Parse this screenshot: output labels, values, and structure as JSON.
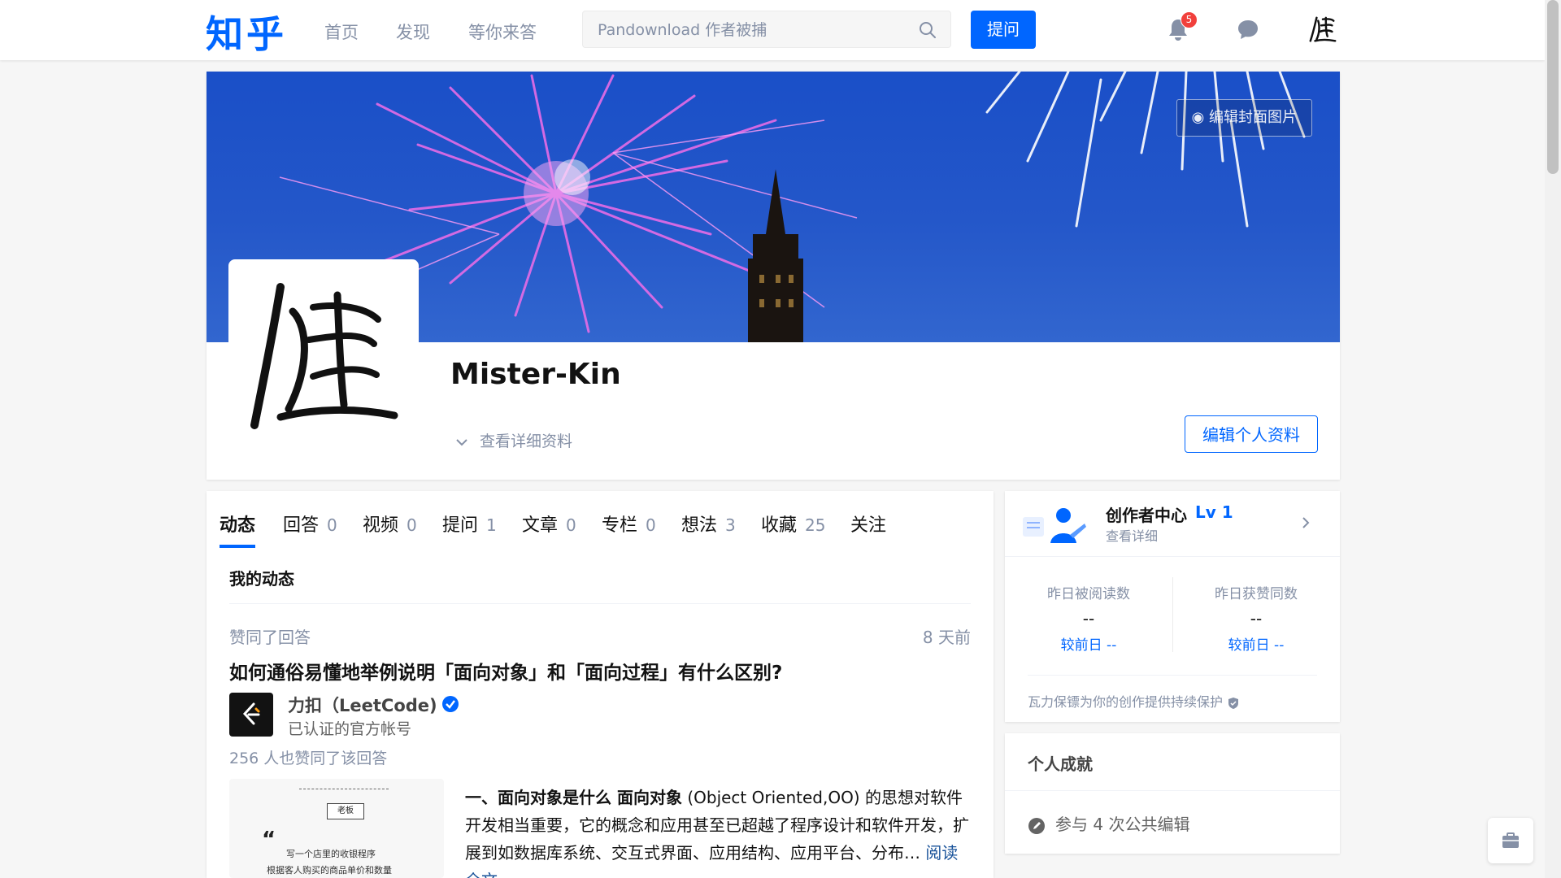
{
  "header": {
    "logo": "知乎",
    "nav": [
      "首页",
      "发现",
      "等你来答"
    ],
    "search_placeholder": "Pandownload 作者被捕",
    "ask_label": "提问",
    "notification_count": "5",
    "brand_color": "#0066ff"
  },
  "profile": {
    "edit_cover_label": "编辑封面图片",
    "username": "Mister-Kin",
    "view_details": "查看详细资料",
    "edit_profile": "编辑个人资料"
  },
  "tabs": [
    {
      "label": "动态",
      "count": ""
    },
    {
      "label": "回答",
      "count": "0"
    },
    {
      "label": "视频",
      "count": "0"
    },
    {
      "label": "提问",
      "count": "1"
    },
    {
      "label": "文章",
      "count": "0"
    },
    {
      "label": "专栏",
      "count": "0"
    },
    {
      "label": "想法",
      "count": "3"
    },
    {
      "label": "收藏",
      "count": "25"
    },
    {
      "label": "关注",
      "count": ""
    }
  ],
  "feed": {
    "section_title": "我的动态",
    "item": {
      "action": "赞同了回答",
      "time": "8 天前",
      "title": "如何通俗易懂地举例说明「面向对象」和「面向过程」有什么区别?",
      "author_name": "力扣（LeetCode)",
      "author_desc": "已认证的官方帐号",
      "likes": "256 人也赞同了该回答",
      "thumb_box": "老板",
      "thumb_quote": "“",
      "thumb_line1": "写一个店里的收银程序",
      "thumb_line2": "根据客人购买的商品单价和数量",
      "excerpt_bold": "一、面向对象是什么 面向对象",
      "excerpt_text": " (Object Oriented,OO) 的思想对软件开发相当重要，它的概念和应用甚至已超越了程序设计和软件开发，扩展到如数据库系统、交互式界面、应用结构、应用平台、分布…",
      "read_more": "阅读全文"
    }
  },
  "creator": {
    "title": "创作者中心",
    "level": "Lv 1",
    "subtitle": "查看详细",
    "stats": [
      {
        "label": "昨日被阅读数",
        "value": "--",
        "compare": "较前日 --"
      },
      {
        "label": "昨日获赞同数",
        "value": "--",
        "compare": "较前日 --"
      }
    ],
    "protect": "瓦力保镖为你的创作提供持续保护"
  },
  "achievements": {
    "title": "个人成就",
    "item": "参与 4 次公共编辑"
  }
}
